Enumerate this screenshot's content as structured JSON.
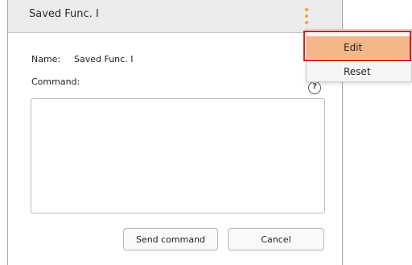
{
  "panel": {
    "title": "Saved Func. I",
    "name_label": "Name:",
    "name_value": "Saved Func. I",
    "command_label": "Command:",
    "command_value": "",
    "help_icon": "?",
    "send_label": "Send command",
    "cancel_label": "Cancel"
  },
  "menu": {
    "items": [
      {
        "label": "Edit",
        "highlighted": true
      },
      {
        "label": "Reset",
        "highlighted": false
      }
    ]
  },
  "colors": {
    "accent": "#f5a031",
    "menu_highlight": "#f4b78a",
    "annotation": "#d62020"
  },
  "icons": [
    "kebab-menu-icon",
    "help-icon"
  ]
}
